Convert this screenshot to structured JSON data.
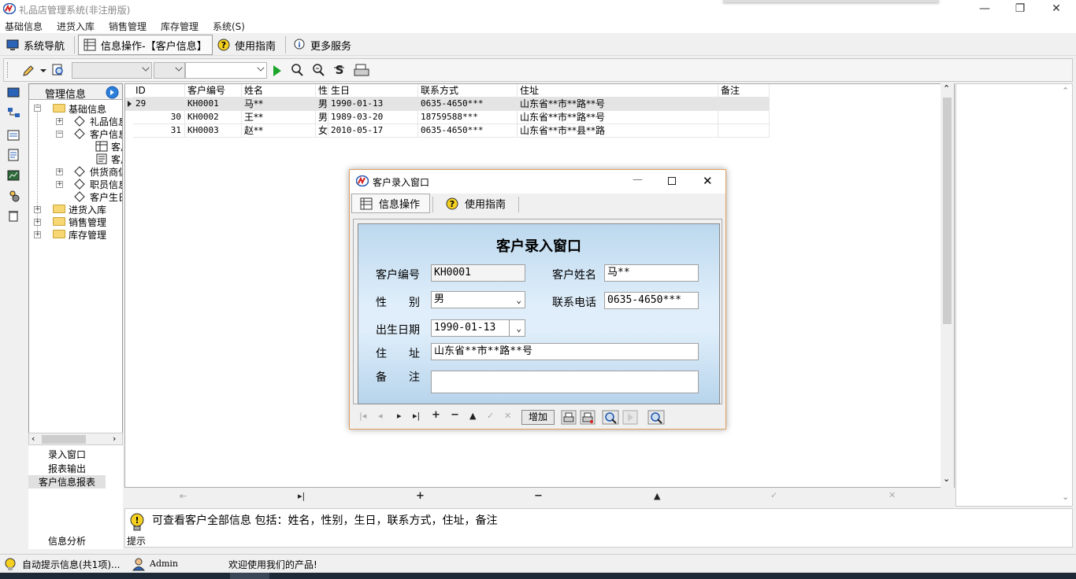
{
  "window": {
    "title": "礼品店管理系统(非注册版)",
    "min": "—",
    "restore": "❐",
    "close": "✕"
  },
  "menubar": [
    "基础信息",
    "进货入库",
    "销售管理",
    "库存管理",
    "系统(S)"
  ],
  "navbar": {
    "nav": "系统导航",
    "info_op": "信息操作-【客户信息】",
    "guide": "使用指南",
    "more": "更多服务"
  },
  "tree": {
    "header": "管理信息",
    "nodes": [
      "基础信息",
      "礼品信息",
      "客户信息",
      "客户信息录入",
      "客户信息报表",
      "供货商信息",
      "职员信息",
      "客户生日",
      "进货入库",
      "销售管理",
      "库存管理"
    ]
  },
  "left_bottom": {
    "items": [
      "录入窗口",
      "报表输出",
      "客户信息报表"
    ],
    "footer": "信息分析"
  },
  "grid": {
    "columns": [
      "ID",
      "客户编号",
      "姓名",
      "性",
      "生日",
      "联系方式",
      "住址",
      "备注"
    ],
    "rows": [
      [
        "29",
        "KH0001",
        "马**",
        "男",
        "1990-01-13",
        "0635-4650***",
        "山东省**市**路**号",
        ""
      ],
      [
        "30",
        "KH0002",
        "王**",
        "男",
        "1989-03-20",
        "18759588***",
        "山东省**市**路**号",
        ""
      ],
      [
        "31",
        "KH0003",
        "赵**",
        "女",
        "2010-05-17",
        "0635-4650***",
        "山东省**市**县**路",
        ""
      ]
    ]
  },
  "hint": {
    "text": "可查看客户全部信息 包括：姓名，性别，生日，联系方式，住址，备注",
    "label": "提示"
  },
  "status": {
    "auto_hint": "自动提示信息(共1项)...",
    "user": "Admin",
    "welcome": "欢迎使用我们的产品!"
  },
  "dialog": {
    "title": "客户录入窗口",
    "tab_info": "信息操作",
    "tab_guide": "使用指南",
    "heading": "客户录入窗口",
    "fields": {
      "code_label": "客户编号",
      "code_value": "KH0001",
      "name_label": "客户姓名",
      "name_value": "马**",
      "gender_label": "性　　别",
      "gender_value": "男",
      "phone_label": "联系电话",
      "phone_value": "0635-4650***",
      "birth_label": "出生日期",
      "birth_value": "1990-01-13",
      "addr_label": "住　　址",
      "addr_value": "山东省**市**路**号",
      "note_label": "备　　注",
      "note_value": ""
    },
    "add_label": "增加"
  },
  "colors": {
    "accent_blue": "#1f6fc0",
    "selected_row": "#e4e4e4",
    "dialog_border": "#e0a060"
  }
}
